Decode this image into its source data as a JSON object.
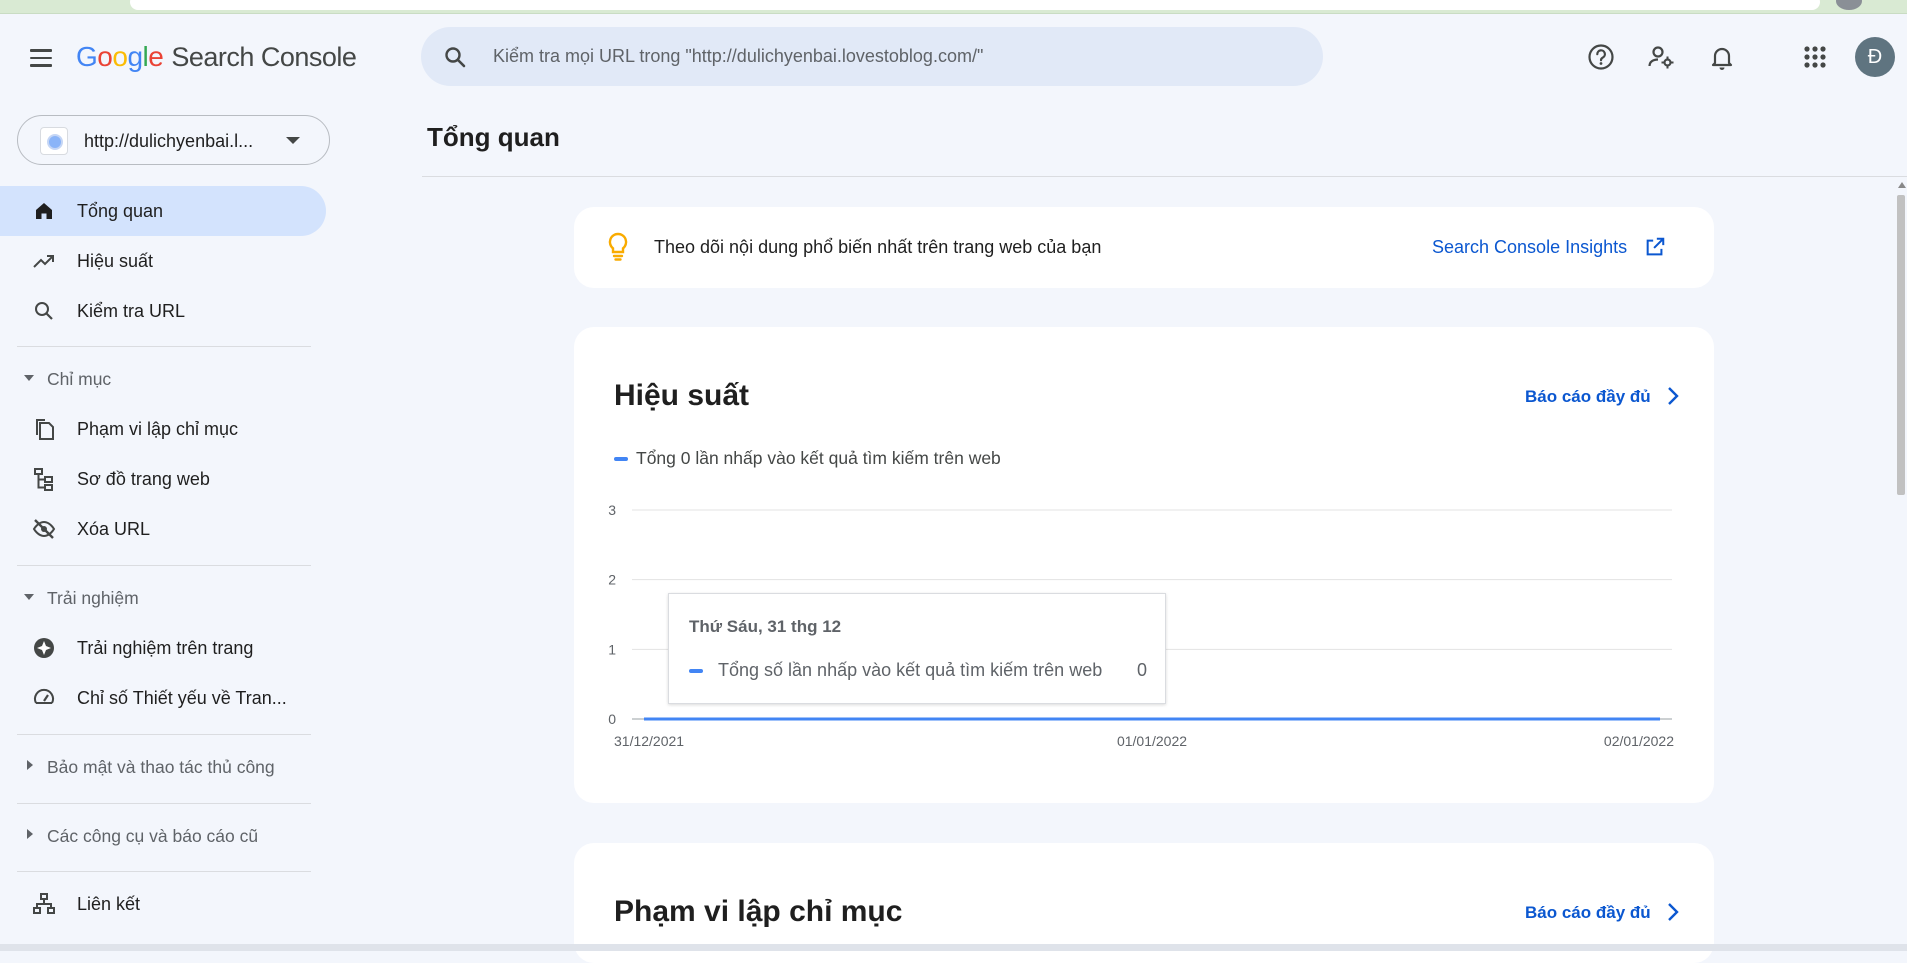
{
  "app": {
    "logo_letters": [
      "G",
      "o",
      "o",
      "g",
      "l",
      "e"
    ],
    "product_name": "Search Console",
    "avatar_initial": "Đ"
  },
  "search": {
    "placeholder": "Kiểm tra mọi URL trong \"http://dulichyenbai.lovestoblog.com/\""
  },
  "toolbar_icons": [
    "help-icon",
    "manage-users-icon",
    "notifications-icon",
    "apps-grid-icon"
  ],
  "property": {
    "label": "http://dulichyenbai.l..."
  },
  "sidebar": {
    "items_top": [
      {
        "label": "Tổng quan",
        "icon": "home-icon",
        "active": true
      },
      {
        "label": "Hiệu suất",
        "icon": "trending-up-icon"
      },
      {
        "label": "Kiểm tra URL",
        "icon": "search-icon"
      }
    ],
    "section_index": {
      "label": "Chỉ mục"
    },
    "items_index": [
      {
        "label": "Phạm vi lập chỉ mục",
        "icon": "file-copy-icon"
      },
      {
        "label": "Sơ đồ trang web",
        "icon": "sitemap-icon"
      },
      {
        "label": "Xóa URL",
        "icon": "visibility-off-icon"
      }
    ],
    "section_experience": {
      "label": "Trải nghiệm"
    },
    "items_experience": [
      {
        "label": "Trải nghiệm trên trang",
        "icon": "page-experience-icon"
      },
      {
        "label": "Chỉ số Thiết yếu về Tran...",
        "icon": "speed-gauge-icon"
      }
    ],
    "section_security": {
      "label": "Bảo mật và thao tác thủ công"
    },
    "section_legacy": {
      "label": "Các công cụ và báo cáo cũ"
    },
    "items_bottom": [
      {
        "label": "Liên kết",
        "icon": "links-icon"
      }
    ]
  },
  "main": {
    "title": "Tổng quan",
    "insights": {
      "text": "Theo dõi nội dung phổ biến nhất trên trang web của bạn",
      "link": "Search Console Insights"
    },
    "performance": {
      "title": "Hiệu suất",
      "full_report": "Báo cáo đầy đủ",
      "legend": "Tổng 0 lần nhấp vào kết quả tìm kiếm trên web",
      "tooltip": {
        "date": "Thứ Sáu, 31 thg 12",
        "label": "Tổng số lần nhấp vào kết quả tìm kiếm trên web",
        "value": "0"
      }
    },
    "coverage": {
      "title": "Phạm vi lập chỉ mục",
      "full_report": "Báo cáo đầy đủ"
    }
  },
  "colors": {
    "accent": "#0b57d0",
    "series": "#4285f4",
    "active_nav": "#d3e3fd",
    "background": "#f3f6fc"
  },
  "chart_data": {
    "type": "line",
    "x": [
      "31/12/2021",
      "01/01/2022",
      "02/01/2022"
    ],
    "series": [
      {
        "name": "Tổng 0 lần nhấp vào kết quả tìm kiếm trên web",
        "values": [
          0,
          0,
          0
        ]
      }
    ],
    "yticks": [
      0,
      1,
      2,
      3
    ],
    "ylim": [
      0,
      3
    ],
    "grid": true,
    "title": "",
    "xlabel": "",
    "ylabel": ""
  }
}
